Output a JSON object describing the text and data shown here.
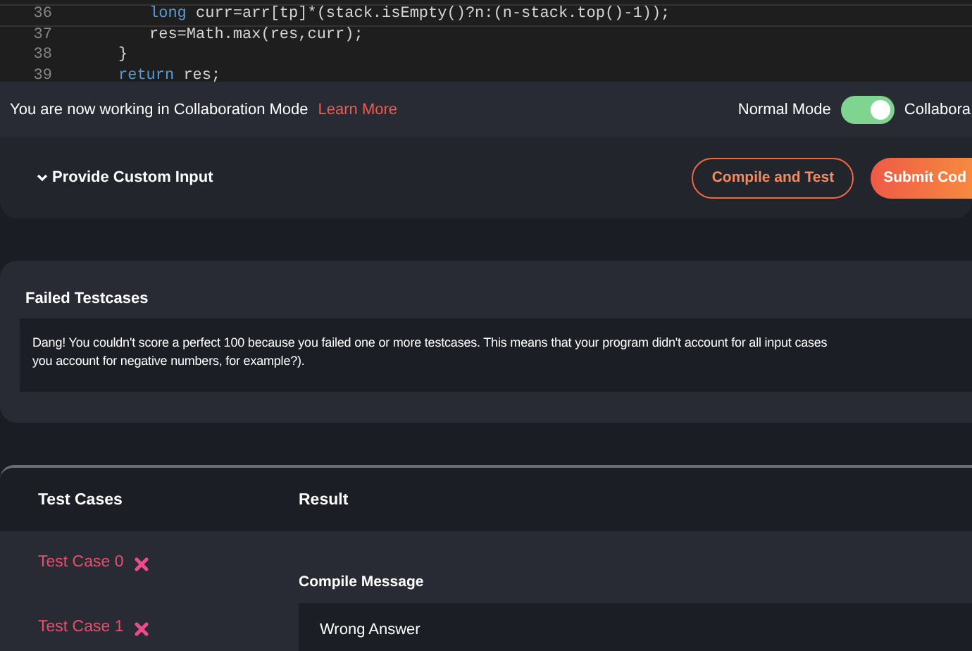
{
  "editor": {
    "lines": [
      {
        "children": [
          {
            "number": "36",
            "tokens": [
              {
                "kind": "keyword",
                "text": "long"
              },
              {
                "kind": "plain",
                "text": " curr=arr[tp]*(stack.isEmpty()?n:(n-stack.top()-1));"
              }
            ]
          },
          {
            "number": "37",
            "tokens": [
              {
                "kind": "plain",
                "text": "res=Math.max(res,curr);"
              }
            ]
          }
        ]
      },
      {
        "number": "38",
        "tokens": [
          {
            "kind": "plain",
            "text": "}"
          }
        ]
      },
      {
        "number": "39",
        "tokens": [
          {
            "kind": "keyword",
            "text": "return"
          },
          {
            "kind": "plain",
            "text": " res;"
          }
        ]
      }
    ]
  },
  "collab_bar": {
    "message": "You are now working in Collaboration Mode",
    "link": "Learn More",
    "left_label": "Normal Mode",
    "toggle": {
      "on": true
    },
    "right_label": "Collabora"
  },
  "custom_input": {
    "label": "Provide Custom Input",
    "expanded": false,
    "buttons": [
      {
        "kind": "outline",
        "label": "Compile and Test"
      },
      {
        "kind": "filled",
        "label": "Submit Cod"
      }
    ]
  },
  "failed_panel": {
    "title": "Failed Testcases",
    "message_lines": [
      "Dang! You couldn't score a perfect 100 because you failed one or more testcases. This means that your program didn't account for all input cases",
      "you account for negative numbers, for example?)."
    ]
  },
  "results": {
    "test_cases_heading": "Test Cases",
    "result_heading": "Result",
    "test_cases": [
      {
        "label": "Test Case 0",
        "passed": false
      },
      {
        "label": "Test Case 1",
        "passed": false
      }
    ],
    "compile_message_heading": "Compile Message",
    "compile_message": "Wrong Answer"
  }
}
